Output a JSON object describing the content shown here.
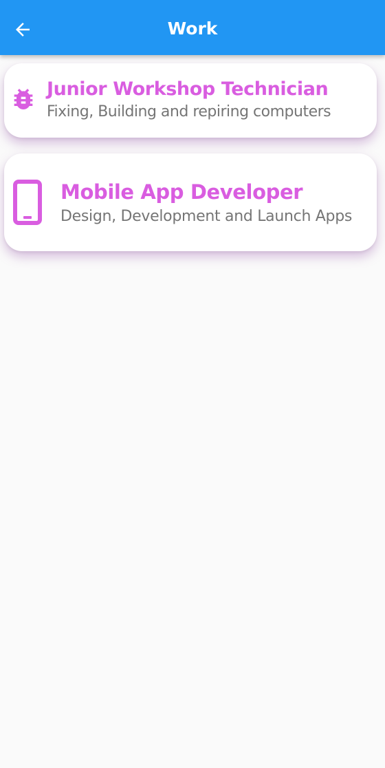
{
  "appbar": {
    "title": "Work",
    "back_icon": "arrow-left-icon",
    "background_color": "#2196f3"
  },
  "jobs": [
    {
      "title": "Junior Workshop Technician",
      "description": "Fixing, Building and repiring computers",
      "icon": "bug-icon"
    },
    {
      "title": "Mobile App Developer",
      "description": "Design, Development and Launch Apps",
      "icon": "smartphone-icon"
    }
  ],
  "colors": {
    "accent": "#d95de0",
    "secondary_text": "#757575",
    "page_background": "#fafafa"
  }
}
